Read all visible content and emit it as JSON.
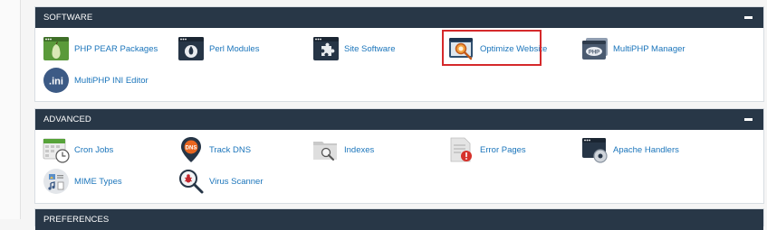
{
  "sections": [
    {
      "title": "SOFTWARE",
      "items": [
        {
          "label": "PHP PEAR Packages",
          "icon": "php-pear-icon"
        },
        {
          "label": "Perl Modules",
          "icon": "perl-modules-icon"
        },
        {
          "label": "Site Software",
          "icon": "site-software-icon"
        },
        {
          "label": "Optimize Website",
          "icon": "optimize-website-icon"
        },
        {
          "label": "MultiPHP Manager",
          "icon": "multiphp-manager-icon"
        },
        {
          "label": "MultiPHP INI Editor",
          "icon": "multiphp-ini-editor-icon"
        }
      ]
    },
    {
      "title": "ADVANCED",
      "items": [
        {
          "label": "Cron Jobs",
          "icon": "cron-jobs-icon"
        },
        {
          "label": "Track DNS",
          "icon": "track-dns-icon"
        },
        {
          "label": "Indexes",
          "icon": "indexes-icon"
        },
        {
          "label": "Error Pages",
          "icon": "error-pages-icon"
        },
        {
          "label": "Apache Handlers",
          "icon": "apache-handlers-icon"
        },
        {
          "label": "MIME Types",
          "icon": "mime-types-icon"
        },
        {
          "label": "Virus Scanner",
          "icon": "virus-scanner-icon"
        }
      ]
    },
    {
      "title": "PREFERENCES"
    }
  ],
  "icon_text": {
    "ini": ".ini",
    "dns": "DNS",
    "php": "PHP"
  },
  "colors": {
    "header_bg": "#283747",
    "link": "#1b75bb",
    "highlight": "#d5292b"
  }
}
